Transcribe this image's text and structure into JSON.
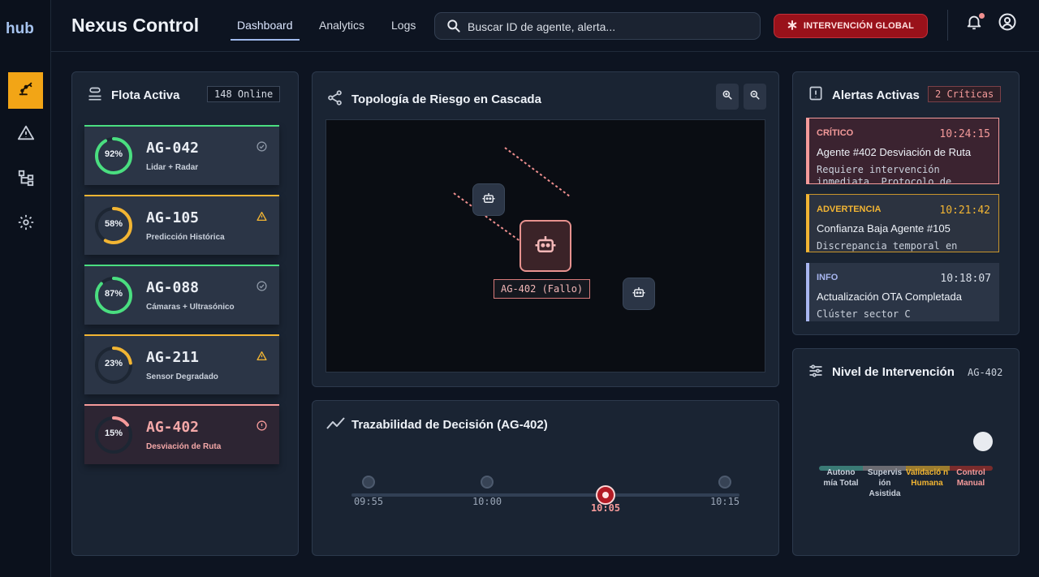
{
  "brand": "hub",
  "app_title": "Nexus Control",
  "nav": {
    "tabs": [
      "Dashboard",
      "Analytics",
      "Logs"
    ],
    "active": "Dashboard"
  },
  "search": {
    "placeholder": "Buscar ID de agente, alerta..."
  },
  "global_button": "INTERVENCIÓN GLOBAL",
  "sidebar": {
    "icons": [
      "robot-arm-icon",
      "warning-icon",
      "topology-icon",
      "gear-icon"
    ],
    "active": "robot-arm-icon"
  },
  "fleet": {
    "title": "Flota Activa",
    "badge": "148 Online",
    "agents": [
      {
        "id": "AG-042",
        "pct_label": "92%",
        "pct": 92,
        "sub": "Lidar + Radar",
        "status": "ok"
      },
      {
        "id": "AG-105",
        "pct_label": "58%",
        "pct": 58,
        "sub": "Predicción Histórica",
        "status": "warn"
      },
      {
        "id": "AG-088",
        "pct_label": "87%",
        "pct": 87,
        "sub": "Cámaras + Ultrasónico",
        "status": "ok"
      },
      {
        "id": "AG-211",
        "pct_label": "23%",
        "pct": 23,
        "sub": "Sensor Degradado",
        "status": "warn"
      },
      {
        "id": "AG-402",
        "pct_label": "15%",
        "pct": 15,
        "sub": "Desviación de Ruta",
        "status": "fail"
      }
    ]
  },
  "topology": {
    "title": "Topología de Riesgo en Cascada",
    "failed_label": "AG-402 (Fallo)"
  },
  "timeline": {
    "title": "Trazabilidad de Decisión (AG-402)",
    "times": [
      "09:55",
      "10:00",
      "10:05",
      "10:15"
    ],
    "active_index": 2
  },
  "alerts": {
    "title": "Alertas Activas",
    "badge": "2 Críticas",
    "items": [
      {
        "level": "CRÍTICO",
        "time": "10:24:15",
        "title": "Agente #402 Desviación de Ruta",
        "desc": "Requiere intervención inmediata. Protocolo de",
        "kind": "crit"
      },
      {
        "level": "ADVERTENCIA",
        "time": "10:21:42",
        "title": "Confianza Baja Agente #105",
        "desc": "Discrepancia temporal en",
        "kind": "warn"
      },
      {
        "level": "INFO",
        "time": "10:18:07",
        "title": "Actualización OTA Completada",
        "desc": "Clúster sector C",
        "kind": "info"
      }
    ]
  },
  "intervention": {
    "title": "Nivel de Intervención",
    "agent": "AG-402",
    "levels": [
      "Autono mía Total",
      "Supervis ión Asistida",
      "Validació n Humana",
      "Control Manual"
    ],
    "selected_index": 3
  },
  "colors": {
    "accent": "#f2a516",
    "ok": "#4ade80",
    "warn": "#f2b533",
    "critical": "#f49a9a",
    "danger": "#99111a"
  }
}
